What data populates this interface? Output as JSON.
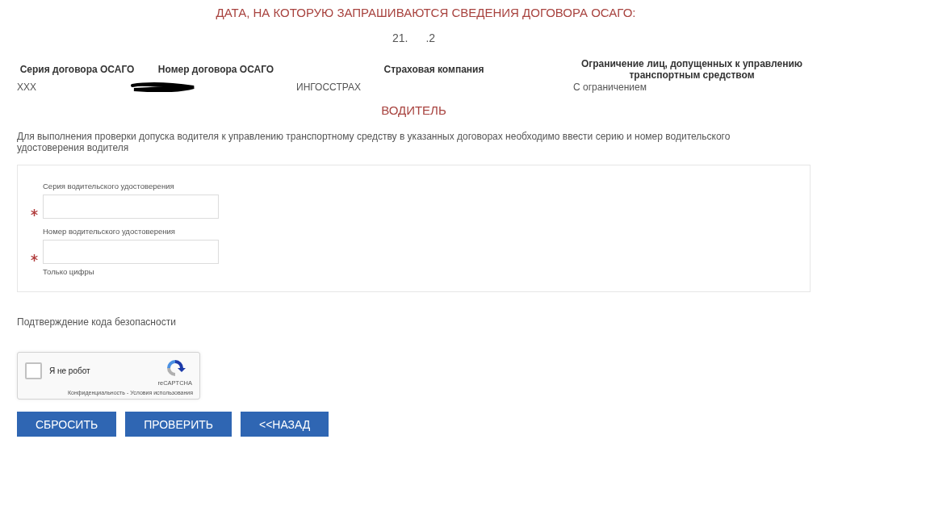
{
  "header": {
    "title": "ДАТА, НА КОТОРУЮ ЗАПРАШИВАЮТСЯ СВЕДЕНИЯ ДОГОВОРА ОСАГО:",
    "date_parts": [
      "21.",
      ".2"
    ]
  },
  "policy_table": {
    "columns": [
      "Серия договора ОСАГО",
      "Номер договора ОСАГО",
      "Страховая компания",
      "Ограничение лиц, допущенных к управлению транспортным средством"
    ],
    "rows": [
      [
        {
          "kind": "text",
          "text": "XXX"
        },
        {
          "kind": "redacted"
        },
        {
          "kind": "text",
          "text": "ИНГОССТРАХ"
        },
        {
          "kind": "text",
          "text": "С ограничением"
        }
      ]
    ]
  },
  "section_title": "ВОДИТЕЛЬ",
  "instructions": "Для выполнения проверки допуска водителя к управлению транспортному средству в указанных договорах необходимо ввести серию и номер водительского удостоверения водителя",
  "license_form": {
    "fields": [
      {
        "label": "Серия водительского удостоверения",
        "required": true
      },
      {
        "label": "Номер водительского удостоверения",
        "required": true,
        "hint": "Только цифры"
      }
    ]
  },
  "security": {
    "label": "Подтверждение кода безопасности",
    "captcha": {
      "checked": false,
      "label": "Я не робот",
      "brand": "reCAPTCHA",
      "links": [
        "Конфиденциальность",
        "Условия использования"
      ],
      "link_separator": "-"
    }
  },
  "buttons": [
    "СБРОСИТЬ",
    "ПРОВЕРИТЬ",
    "<<НАЗАД"
  ]
}
